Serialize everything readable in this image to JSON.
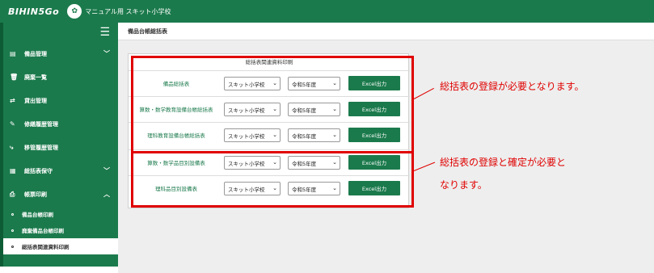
{
  "brand": {
    "logo_text": "BIHIN5Go",
    "school_name": "マニュアル用 スキット小学校"
  },
  "sidebar": {
    "items": [
      {
        "label": "備品管理",
        "icon": "▤",
        "chevron": "﹀"
      },
      {
        "label": "廃棄一覧",
        "icon": "🗑",
        "chevron": ""
      },
      {
        "label": "貸出管理",
        "icon": "⇄",
        "chevron": ""
      },
      {
        "label": "修繕履歴管理",
        "icon": "✎",
        "chevron": ""
      },
      {
        "label": "移管履歴管理",
        "icon": "⤷",
        "chevron": ""
      },
      {
        "label": "総括表保守",
        "icon": "▦",
        "chevron": "﹀"
      },
      {
        "label": "帳票印刷",
        "icon": "⎙",
        "chevron": "︿"
      }
    ],
    "sub_items": [
      {
        "label": "備品台帳印刷"
      },
      {
        "label": "廃棄備品台帳印刷"
      },
      {
        "label": "総括表関連資料印刷"
      }
    ]
  },
  "breadcrumb": "備品台帳総括表",
  "panel": {
    "title": "総括表関連資料印刷",
    "rows": [
      {
        "label": "備品総括表",
        "school": "スキット小学校",
        "year": "令和5年度",
        "button": "Excel出力"
      },
      {
        "label": "算数・数学教育設備台帳総括表",
        "school": "スキット小学校",
        "year": "令和5年度",
        "button": "Excel出力"
      },
      {
        "label": "理科教育設備台帳総括表",
        "school": "スキット小学校",
        "year": "令和5年度",
        "button": "Excel出力"
      },
      {
        "label": "算数・数学品目別設備表",
        "school": "スキット小学校",
        "year": "令和5年度",
        "button": "Excel出力"
      },
      {
        "label": "理科品目別設備表",
        "school": "スキット小学校",
        "year": "令和5年度",
        "button": "Excel出力"
      }
    ]
  },
  "callouts": {
    "first": "総括表の登録が必要となります。",
    "second_line1": "総括表の登録と確定が必要と",
    "second_line2": "なります。"
  },
  "colors": {
    "brand_green": "#1b7a4c",
    "highlight_red": "#e00000"
  }
}
